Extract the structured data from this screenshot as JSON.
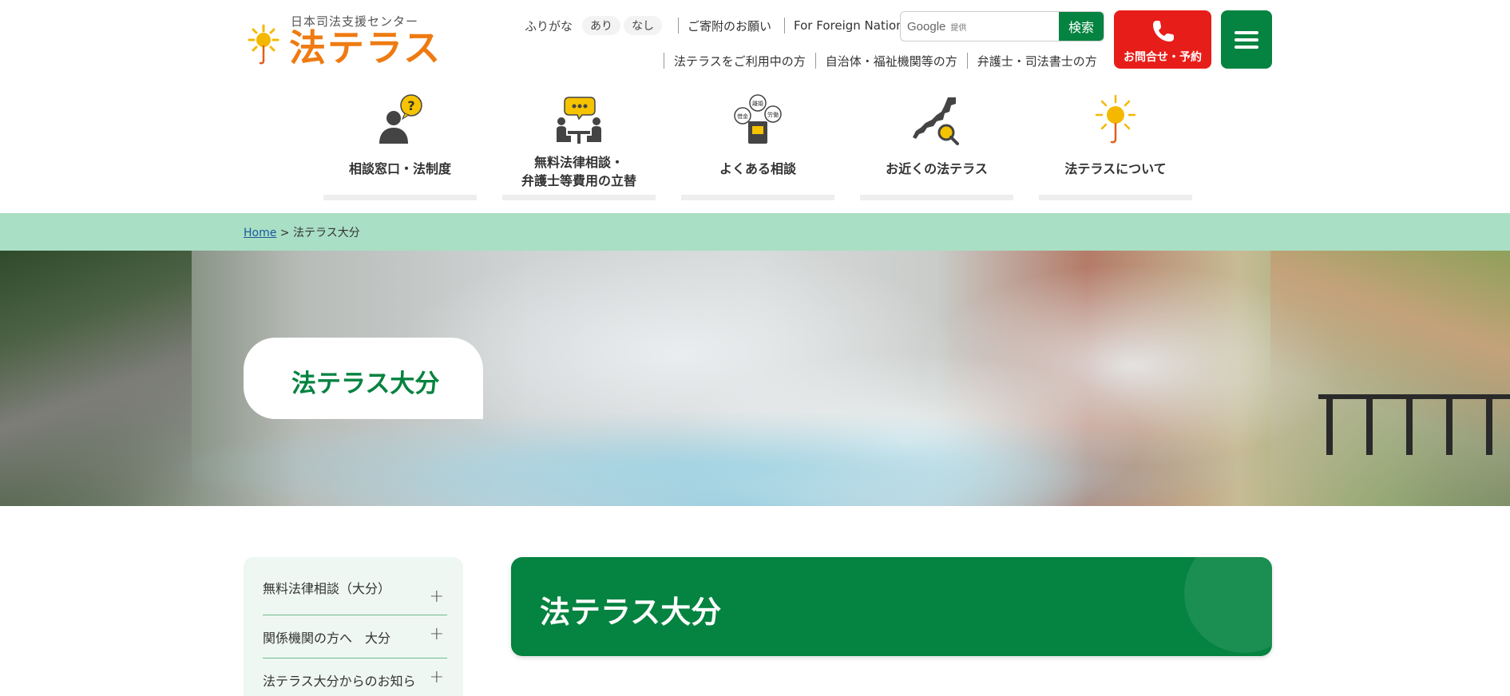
{
  "header": {
    "logo_subtitle": "日本司法支援センター",
    "logo_title": "法テラス",
    "furigana_label": "ふりがな",
    "furigana_on": "あり",
    "furigana_off": "なし",
    "donation_link": "ご寄附のお願い",
    "foreign_link": "For Foreign Nationals",
    "audience_links": [
      "法テラスをご利用中の方",
      "自治体・福祉機関等の方",
      "弁護士・司法書士の方"
    ],
    "search_brand": "Google",
    "search_provided": "提供",
    "search_button": "検索",
    "contact_label": "お問合せ・予約",
    "colors": {
      "brand_green": "#058340",
      "contact_red": "#e71d19",
      "logo_orange": "#ee7b12"
    }
  },
  "global_nav": [
    {
      "label": "相談窓口・法制度",
      "icon": "consultant-question-icon"
    },
    {
      "label_line1": "無料法律相談・",
      "label_line2": "弁護士等費用の立替",
      "icon": "consultation-meeting-icon"
    },
    {
      "label": "よくある相談",
      "icon": "faq-book-icon",
      "icon_words": [
        "離婚",
        "借金",
        "労働"
      ]
    },
    {
      "label": "お近くの法テラス",
      "icon": "japan-map-search-icon"
    },
    {
      "label": "法テラスについて",
      "icon": "sun-umbrella-icon"
    }
  ],
  "breadcrumb": {
    "home": "Home",
    "separator": ">",
    "current": "法テラス大分"
  },
  "hero": {
    "title": "法テラス大分",
    "image": "steaming-hot-spring-pool"
  },
  "side_nav": [
    {
      "label": "無料法律相談（大分）"
    },
    {
      "label": "関係機関の方へ　大分"
    },
    {
      "label": "法テラス大分からのお知ら"
    }
  ],
  "page_heading": "法テラス大分"
}
